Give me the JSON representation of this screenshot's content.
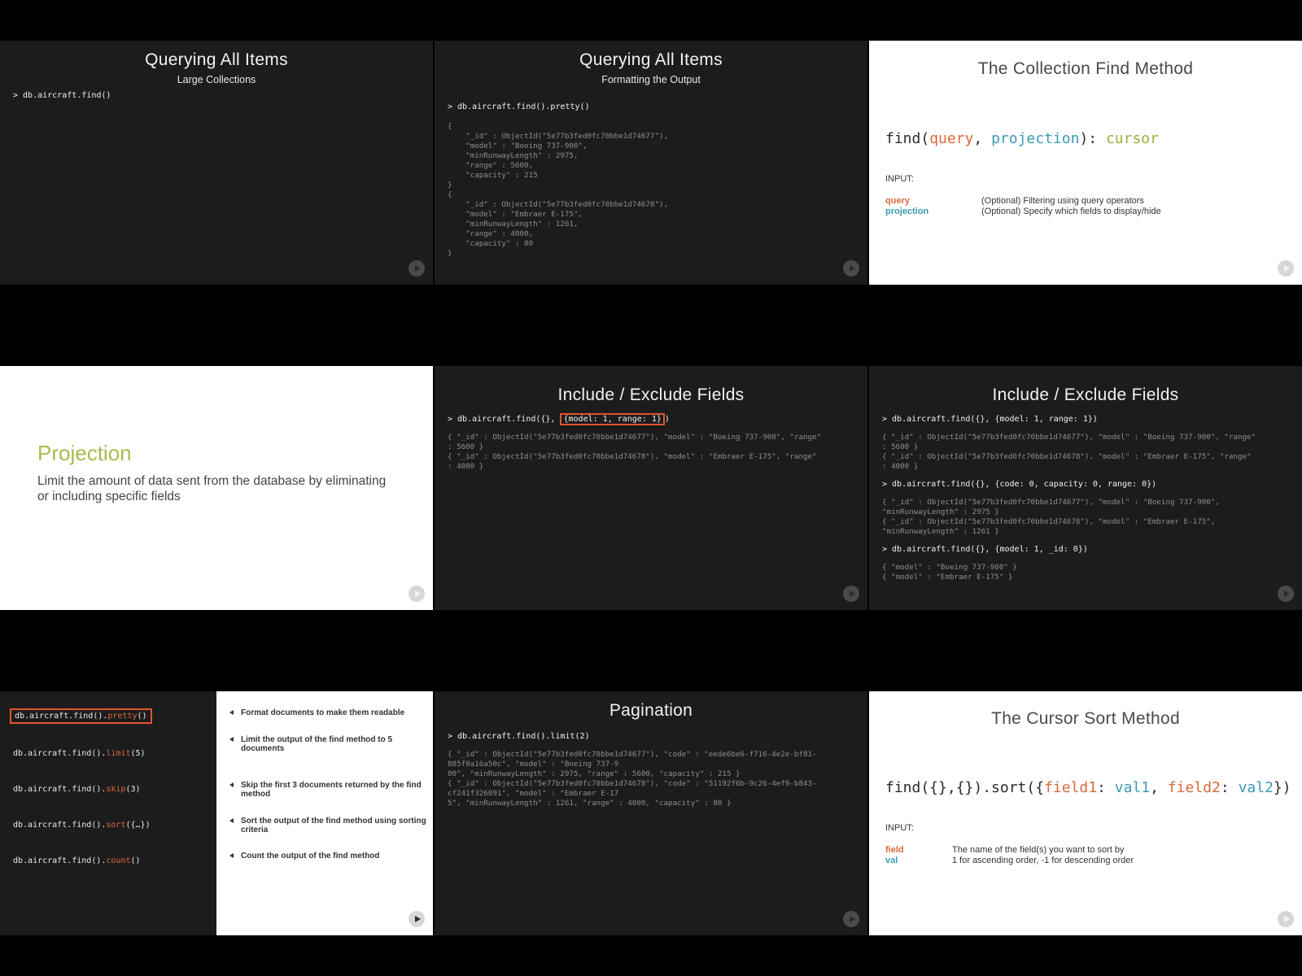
{
  "slide1": {
    "title": "Querying All Items",
    "subtitle": "Large Collections",
    "command": "> db.aircraft.find()"
  },
  "slide2": {
    "title": "Querying All Items",
    "subtitle": "Formatting the Output",
    "command": "> db.aircraft.find().pretty()",
    "output": "{\n    \"_id\" : ObjectId(\"5e77b3fed0fc70bbe1d74677\"),\n    \"model\" : \"Boeing 737-900\",\n    \"minRunwayLength\" : 2975,\n    \"range\" : 5600,\n    \"capacity\" : 215\n}\n{\n    \"_id\" : ObjectId(\"5e77b3fed0fc70bbe1d74678\"),\n    \"model\" : \"Embraer E-175\",\n    \"minRunwayLength\" : 1261,\n    \"range\" : 4000,\n    \"capacity\" : 80\n}"
  },
  "slide3": {
    "title": "The Collection Find Method",
    "signature": {
      "fn": "find(",
      "query": "query",
      "sep": ", ",
      "projection": "projection",
      "close": "): ",
      "ret": "cursor"
    },
    "input_label": "INPUT:",
    "params": [
      {
        "name": "query",
        "desc": "(Optional) Filtering using query operators",
        "color": "#d96a38"
      },
      {
        "name": "projection",
        "desc": "(Optional) Specify which fields to display/hide",
        "color": "#3a9bb7"
      }
    ]
  },
  "slide4": {
    "title": "Projection",
    "description": "Limit the amount of data sent from the database by eliminating or including specific fields"
  },
  "slide5": {
    "title": "Include / Exclude Fields",
    "command_prefix": "> db.aircraft.find({}, ",
    "command_highlight": "{model: 1, range: 1}",
    "command_suffix": ")",
    "output": "{ \"_id\" : ObjectId(\"5e77b3fed0fc70bbe1d74677\"), \"model\" : \"Boeing 737-900\", \"range\"\n: 5600 }\n{ \"_id\" : ObjectId(\"5e77b3fed0fc70bbe1d74678\"), \"model\" : \"Embraer E-175\", \"range\"\n: 4000 }"
  },
  "slide6": {
    "title": "Include / Exclude Fields",
    "blocks": [
      {
        "command": "> db.aircraft.find({}, {model: 1, range: 1})",
        "output": "{ \"_id\" : ObjectId(\"5e77b3fed0fc70bbe1d74677\"), \"model\" : \"Boeing 737-900\", \"range\"\n: 5600 }\n{ \"_id\" : ObjectId(\"5e77b3fed0fc70bbe1d74678\"), \"model\" : \"Embraer E-175\", \"range\"\n: 4000 }"
      },
      {
        "command": "> db.aircraft.find({}, {code: 0, capacity: 0, range: 0})",
        "output": "{ \"_id\" : ObjectId(\"5e77b3fed0fc70bbe1d74677\"), \"model\" : \"Boeing 737-900\",\n\"minRunwayLength\" : 2975 }\n{ \"_id\" : ObjectId(\"5e77b3fed0fc70bbe1d74678\"), \"model\" : \"Embraer E-175\",\n\"minRunwayLength\" : 1261 }"
      },
      {
        "command": "> db.aircraft.find({}, {model: 1, _id: 0})",
        "output": "{ \"model\" : \"Boeing 737-900\" }\n{ \"model\" : \"Embraer E-175\" }"
      }
    ]
  },
  "slide7": {
    "items": [
      {
        "prefix": "db.aircraft.find().",
        "method": "pretty",
        "suffix": "()",
        "desc": "Format documents to make them readable"
      },
      {
        "prefix": "db.aircraft.find().",
        "method": "limit",
        "suffix": "(5)",
        "desc": "Limit the output of the find method to 5 documents"
      },
      {
        "prefix": "db.aircraft.find().",
        "method": "skip",
        "suffix": "(3)",
        "desc": "Skip the first 3 documents returned by the find method"
      },
      {
        "prefix": "db.aircraft.find().",
        "method": "sort",
        "suffix": "({…})",
        "desc": "Sort the output of the find method using sorting criteria"
      },
      {
        "prefix": "db.aircraft.find().",
        "method": "count",
        "suffix": "()",
        "desc": "Count the output of the find method"
      }
    ]
  },
  "slide8": {
    "title": "Pagination",
    "command": "> db.aircraft.find().limit(2)",
    "output": "{ \"_id\" : ObjectId(\"5e77b3fed0fc70bbe1d74677\"), \"code\" : \"eede6be6-f716-4e2e-bf81-\n885f0a16a50c\", \"model\" : \"Boeing 737-9\n00\", \"minRunwayLength\" : 2975, \"range\" : 5600, \"capacity\" : 215 }\n{ \"_id\" : ObjectId(\"5e77b3fed0fc70bbe1d74678\"), \"code\" : \"51192f6b-9c26-4ef9-b843-\ncf241f326091\", \"model\" : \"Embraer E-17\n5\", \"minRunwayLength\" : 1261, \"range\" : 4000, \"capacity\" : 80 }"
  },
  "slide9": {
    "title": "The Cursor Sort Method",
    "signature": {
      "p1": "find({},{}).sort({",
      "f1": "field1",
      "c1": ": ",
      "v1": "val1",
      "s1": ", ",
      "f2": "field2",
      "c2": ": ",
      "v2": "val2",
      "end": "})"
    },
    "input_label": "INPUT:",
    "params": [
      {
        "name": "field",
        "desc": "The name of the field(s) you want to sort by",
        "color": "#d96a38"
      },
      {
        "name": "val",
        "desc": "1 for ascending order, -1 for descending order",
        "color": "#3a9bb7"
      }
    ]
  },
  "icons": {
    "play": "play-icon"
  },
  "colors": {
    "accent_orange": "#d96a38",
    "accent_teal": "#3a9bb7",
    "accent_green": "#9aae3f",
    "projection_title": "#a5bd4e",
    "highlight_border": "#e0552e"
  }
}
